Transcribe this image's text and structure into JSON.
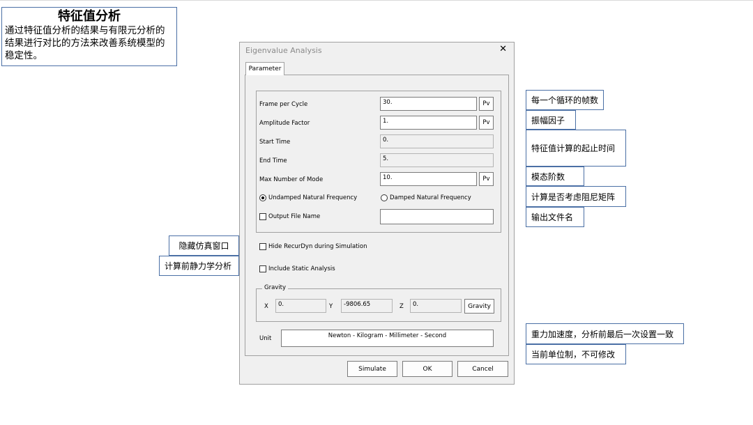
{
  "intro": {
    "title": "特征值分析",
    "body": "通过特征值分析的结果与有限元分析的结果进行对比的方法来改善系统模型的稳定性。"
  },
  "dialog": {
    "title": "Eigenvalue Analysis",
    "close_icon": "close-icon",
    "tab_label": "Parameter",
    "frame_per_cycle": {
      "label": "Frame per Cycle",
      "value": "30.",
      "pv": "Pv"
    },
    "amplitude_factor": {
      "label": "Amplitude Factor",
      "value": "1.",
      "pv": "Pv"
    },
    "start_time": {
      "label": "Start Time",
      "value": "0."
    },
    "end_time": {
      "label": "End Time",
      "value": "5."
    },
    "max_mode": {
      "label": "Max Number of Mode",
      "value": "10.",
      "pv": "Pv"
    },
    "radio_undamped": {
      "label": "Undamped Natural Frequency",
      "selected": true
    },
    "radio_damped": {
      "label": "Damped Natural Frequency",
      "selected": false
    },
    "output_file": {
      "label": "Output File Name",
      "checked": false,
      "value": ""
    },
    "hide_recurdyn": {
      "label": "Hide RecurDyn during Simulation",
      "checked": false
    },
    "include_static": {
      "label": "Include Static Analysis",
      "checked": false
    },
    "gravity": {
      "title": "Gravity",
      "x_label": "X",
      "x_value": "0.",
      "y_label": "Y",
      "y_value": "-9806.65",
      "z_label": "Z",
      "z_value": "0.",
      "button": "Gravity"
    },
    "unit": {
      "label": "Unit",
      "value": "Newton - Kilogram - Millimeter - Second"
    },
    "buttons": {
      "simulate": "Simulate",
      "ok": "OK",
      "cancel": "Cancel"
    }
  },
  "callouts": {
    "frames": "每一个循环的帧数",
    "amplitude": "振幅因子",
    "time_range": "特征值计算的起止时间",
    "modes": "模态阶数",
    "damping": "计算是否考虑阻尼矩阵",
    "output": "输出文件名",
    "hide": "隐藏仿真窗口",
    "static": "计算前静力学分析",
    "gravity": "重力加速度，分析前最后一次设置一致",
    "unit": "当前单位制，不可修改"
  },
  "colors": {
    "callout_border": "#4a6fa5",
    "dialog_bg": "#f0f0f0"
  }
}
